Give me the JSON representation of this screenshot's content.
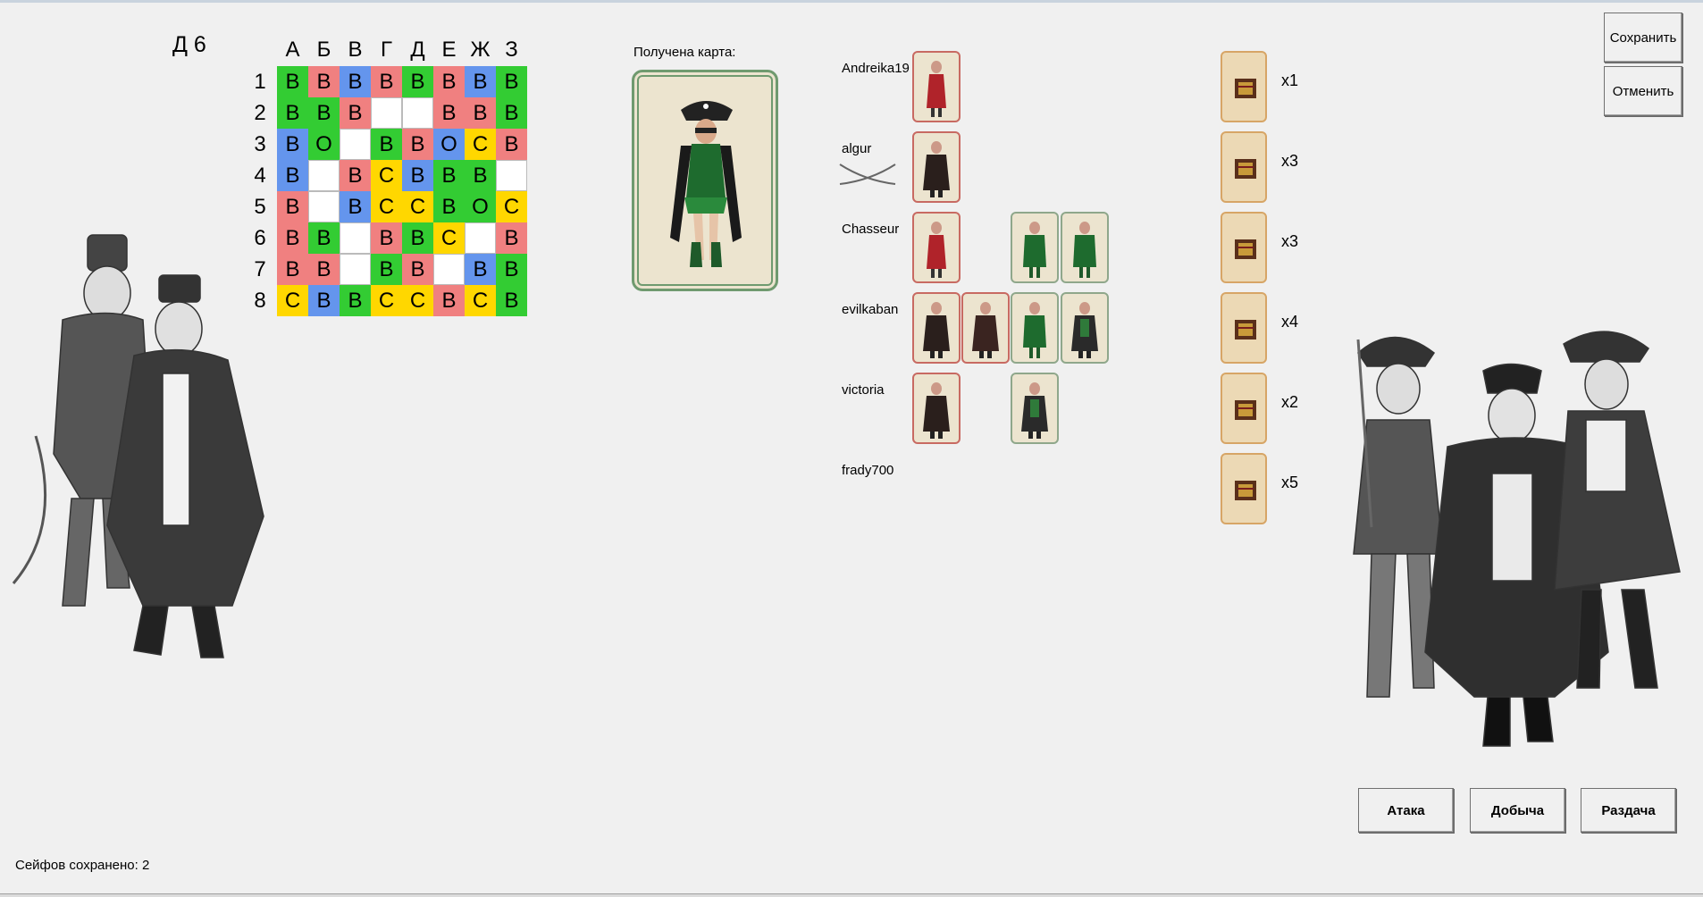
{
  "coordinate": "Д 6",
  "grid": {
    "columns": [
      "А",
      "Б",
      "В",
      "Г",
      "Д",
      "Е",
      "Ж",
      "З"
    ],
    "rows": [
      "1",
      "2",
      "3",
      "4",
      "5",
      "6",
      "7",
      "8"
    ],
    "cells": [
      [
        {
          "t": "В",
          "c": "g"
        },
        {
          "t": "В",
          "c": "r"
        },
        {
          "t": "В",
          "c": "b"
        },
        {
          "t": "В",
          "c": "r"
        },
        {
          "t": "В",
          "c": "g"
        },
        {
          "t": "В",
          "c": "r"
        },
        {
          "t": "В",
          "c": "b"
        },
        {
          "t": "В",
          "c": "g"
        }
      ],
      [
        {
          "t": "В",
          "c": "g"
        },
        {
          "t": "В",
          "c": "g"
        },
        {
          "t": "В",
          "c": "r"
        },
        {
          "t": "",
          "c": "e"
        },
        {
          "t": "",
          "c": "e"
        },
        {
          "t": "В",
          "c": "r"
        },
        {
          "t": "В",
          "c": "r"
        },
        {
          "t": "В",
          "c": "g"
        }
      ],
      [
        {
          "t": "В",
          "c": "b"
        },
        {
          "t": "О",
          "c": "g"
        },
        {
          "t": "",
          "c": "e"
        },
        {
          "t": "В",
          "c": "g"
        },
        {
          "t": "В",
          "c": "r"
        },
        {
          "t": "О",
          "c": "b"
        },
        {
          "t": "С",
          "c": "y"
        },
        {
          "t": "В",
          "c": "r"
        }
      ],
      [
        {
          "t": "В",
          "c": "b"
        },
        {
          "t": "",
          "c": "e"
        },
        {
          "t": "В",
          "c": "r"
        },
        {
          "t": "С",
          "c": "y"
        },
        {
          "t": "В",
          "c": "b"
        },
        {
          "t": "В",
          "c": "g"
        },
        {
          "t": "В",
          "c": "g"
        },
        {
          "t": "",
          "c": "e"
        }
      ],
      [
        {
          "t": "В",
          "c": "r"
        },
        {
          "t": "",
          "c": "e"
        },
        {
          "t": "В",
          "c": "b"
        },
        {
          "t": "С",
          "c": "y"
        },
        {
          "t": "С",
          "c": "y"
        },
        {
          "t": "В",
          "c": "g"
        },
        {
          "t": "О",
          "c": "g"
        },
        {
          "t": "С",
          "c": "y"
        }
      ],
      [
        {
          "t": "В",
          "c": "r"
        },
        {
          "t": "В",
          "c": "g"
        },
        {
          "t": "",
          "c": "e"
        },
        {
          "t": "В",
          "c": "r"
        },
        {
          "t": "В",
          "c": "g"
        },
        {
          "t": "С",
          "c": "y"
        },
        {
          "t": "",
          "c": "e"
        },
        {
          "t": "В",
          "c": "r"
        }
      ],
      [
        {
          "t": "В",
          "c": "r"
        },
        {
          "t": "В",
          "c": "r"
        },
        {
          "t": "",
          "c": "e"
        },
        {
          "t": "В",
          "c": "g"
        },
        {
          "t": "В",
          "c": "r"
        },
        {
          "t": "",
          "c": "e"
        },
        {
          "t": "В",
          "c": "b"
        },
        {
          "t": "В",
          "c": "g"
        }
      ],
      [
        {
          "t": "С",
          "c": "y"
        },
        {
          "t": "В",
          "c": "b"
        },
        {
          "t": "В",
          "c": "g"
        },
        {
          "t": "С",
          "c": "y"
        },
        {
          "t": "С",
          "c": "y"
        },
        {
          "t": "В",
          "c": "r"
        },
        {
          "t": "С",
          "c": "y"
        },
        {
          "t": "В",
          "c": "g"
        }
      ]
    ]
  },
  "received_card": {
    "label": "Получена карта:",
    "icon": "pirate-woman-card"
  },
  "players": [
    {
      "name": "Andreika19"
    },
    {
      "name": "algur"
    },
    {
      "name": "Chasseur"
    },
    {
      "name": "evilkaban"
    },
    {
      "name": "victoria"
    },
    {
      "name": "frady700"
    }
  ],
  "chests": [
    {
      "count": "x1"
    },
    {
      "count": "x3"
    },
    {
      "count": "x3"
    },
    {
      "count": "x4"
    },
    {
      "count": "x2"
    },
    {
      "count": "x5"
    }
  ],
  "buttons": {
    "save": "Сохранить",
    "cancel": "Отменить",
    "attack": "Атака",
    "loot": "Добыча",
    "deal": "Раздача"
  },
  "status": "Сейфов сохранено: 2",
  "colors": {
    "g": "#33cc33",
    "r": "#f08080",
    "b": "#6495ed",
    "y": "#ffd700",
    "e": "#ffffff"
  }
}
